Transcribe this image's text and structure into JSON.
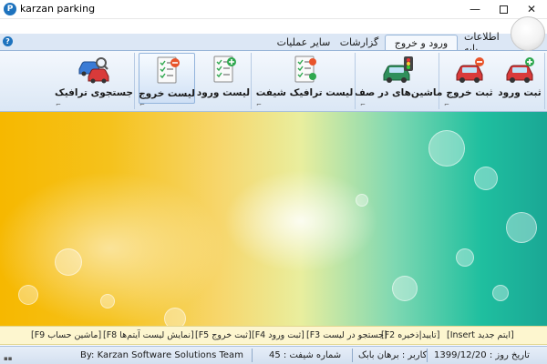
{
  "window": {
    "title": "karzan parking",
    "app_icon_letter": "P",
    "qat_chevron": "▾",
    "minimize_glyph": "—",
    "close_glyph": "✕"
  },
  "help_glyph": "?",
  "tabs": [
    {
      "label": "اطلاعات پایه",
      "active": false
    },
    {
      "label": "ورود و خروج",
      "active": true
    },
    {
      "label": "گزارشات",
      "active": false
    },
    {
      "label": "سایر عملیات",
      "active": false
    }
  ],
  "ribbon": {
    "launcher_glyph": "⌐",
    "buttons": {
      "entry": {
        "label": "ثبت ورود",
        "icon": "car-entry-icon"
      },
      "exit": {
        "label": "ثبت خروج",
        "icon": "car-exit-icon"
      },
      "queue": {
        "label": "ماشین‌های در صف",
        "icon": "car-queue-icon"
      },
      "shift_traffic": {
        "label": "لیست ترافیک شیفت",
        "icon": "checklist-icon"
      },
      "entry_list": {
        "label": "لیست ورود",
        "icon": "checklist-add-icon"
      },
      "exit_list": {
        "label": "لیست خروج",
        "icon": "checklist-remove-icon"
      },
      "traffic_search": {
        "label": "جستجوی ترافیک",
        "icon": "car-search-icon"
      }
    }
  },
  "shortcuts": {
    "insert": "[Insert ایتم جدید]",
    "f2": "[F2 تایید|ذخیره]",
    "f3": "[F3 جستجو در لیست]",
    "f4": "[F4 ثبت ورود]",
    "f5": "[F5 ثبت خروج]",
    "f8": "[F8 نمایش لیست آیتم‌ها]",
    "f9": "[F9 ماشین حساب]"
  },
  "status": {
    "date": "تاریخ روز : 1399/12/20",
    "user": "کاربر : برهان بابک",
    "shift": "شماره شیفت : 45",
    "credit": "By: Karzan Software Solutions Team",
    "grip_glyph": "▪▪"
  },
  "colors": {
    "ribbon_bg": "#dbe7f5",
    "shortcut_bg": "#fdf6cf",
    "accent_blue": "#1e73be"
  }
}
